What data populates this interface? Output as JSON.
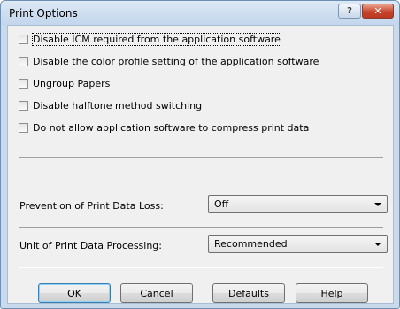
{
  "window": {
    "title": "Print Options",
    "help_glyph": "?",
    "close_glyph": "✕"
  },
  "options": [
    {
      "label": "Disable ICM required from the application software",
      "checked": false
    },
    {
      "label": "Disable the color profile setting of the application software",
      "checked": false
    },
    {
      "label": "Ungroup Papers",
      "checked": false
    },
    {
      "label": "Disable halftone method switching",
      "checked": false
    },
    {
      "label": "Do not allow application software to compress print data",
      "checked": false
    }
  ],
  "fields": {
    "data_loss": {
      "label": "Prevention of Print Data Loss:",
      "value": "Off"
    },
    "processing": {
      "label": "Unit of Print Data Processing:",
      "value": "Recommended"
    }
  },
  "buttons": {
    "ok": "OK",
    "cancel": "Cancel",
    "defaults": "Defaults",
    "help": "Help"
  }
}
